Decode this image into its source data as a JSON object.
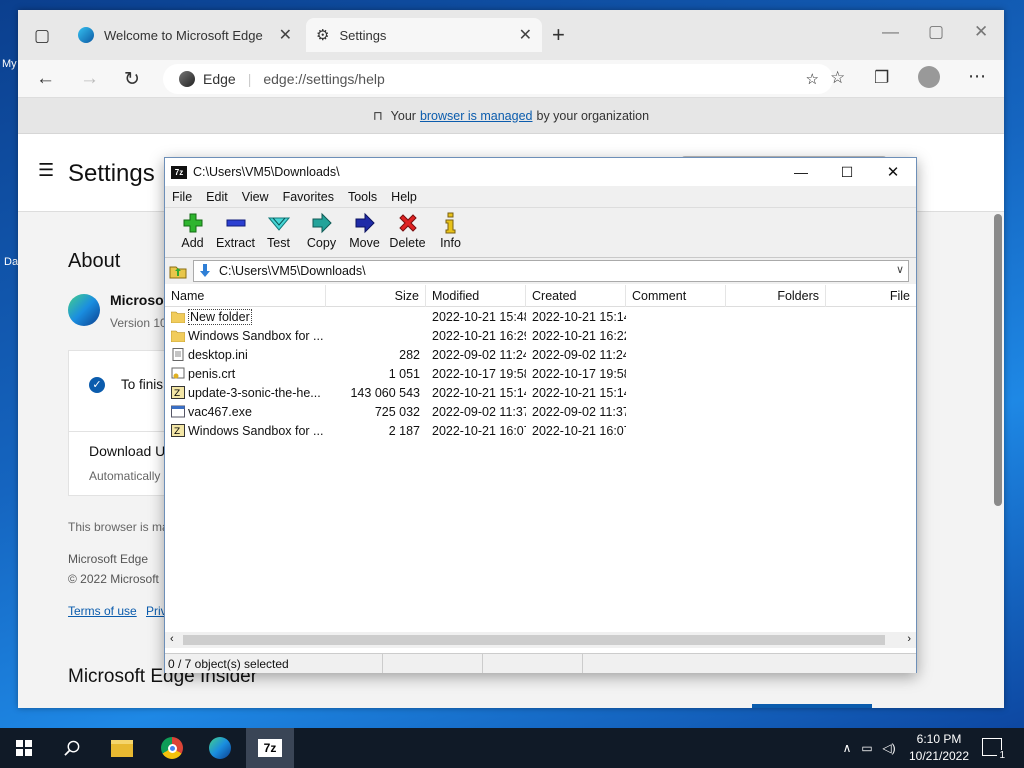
{
  "desktop": {
    "labels": [
      "My",
      "Da"
    ]
  },
  "edge": {
    "tabs": [
      {
        "label": "Welcome to Microsoft Edge"
      },
      {
        "label": "Settings"
      }
    ],
    "address": {
      "site_label": "Edge",
      "url": "edge://settings/help"
    },
    "managed_notice": {
      "before": "Your",
      "link": "browser is managed",
      "after": "by your organization"
    },
    "settings": {
      "title": "Settings",
      "about": "About",
      "product_name_partial": "Microsof",
      "version_partial": "Version 10",
      "finish_partial": "To finis",
      "download_partial": "Download U",
      "auto_partial": "Automatically",
      "managed_partial": "This browser is ma",
      "footer_name": "Microsoft Edge",
      "copyright_partial": "© 2022 Microsoft",
      "terms": "Terms of use",
      "privacy_partial": "Priv",
      "insider_partial": "Microsoft Edge Insider"
    }
  },
  "sevenzip": {
    "title": "C:\\Users\\VM5\\Downloads\\",
    "menu": [
      "File",
      "Edit",
      "View",
      "Favorites",
      "Tools",
      "Help"
    ],
    "toolbar": [
      "Add",
      "Extract",
      "Test",
      "Copy",
      "Move",
      "Delete",
      "Info"
    ],
    "path": "C:\\Users\\VM5\\Downloads\\",
    "columns": [
      "Name",
      "Size",
      "Modified",
      "Created",
      "Comment",
      "Folders",
      "File"
    ],
    "rows": [
      {
        "name": "New folder",
        "size": "",
        "modified": "2022-10-21 15:48",
        "created": "2022-10-21 15:14",
        "icon": "folder"
      },
      {
        "name": "Windows Sandbox for ...",
        "size": "",
        "modified": "2022-10-21 16:29",
        "created": "2022-10-21 16:22",
        "icon": "folder"
      },
      {
        "name": "desktop.ini",
        "size": "282",
        "modified": "2022-09-02 11:24",
        "created": "2022-09-02 11:24",
        "icon": "ini"
      },
      {
        "name": "penis.crt",
        "size": "1 051",
        "modified": "2022-10-17 19:58",
        "created": "2022-10-17 19:58",
        "icon": "cert"
      },
      {
        "name": "update-3-sonic-the-he...",
        "size": "143 060 543",
        "modified": "2022-10-21 15:14",
        "created": "2022-10-21 15:14",
        "icon": "archive"
      },
      {
        "name": "vac467.exe",
        "size": "725 032",
        "modified": "2022-09-02 11:37",
        "created": "2022-09-02 11:37",
        "icon": "exe"
      },
      {
        "name": "Windows Sandbox for ...",
        "size": "2 187",
        "modified": "2022-10-21 16:07",
        "created": "2022-10-21 16:07",
        "icon": "archive"
      }
    ],
    "status": "0 / 7 object(s) selected"
  },
  "taskbar": {
    "time": "6:10 PM",
    "date": "10/21/2022",
    "notification_count": "1"
  }
}
